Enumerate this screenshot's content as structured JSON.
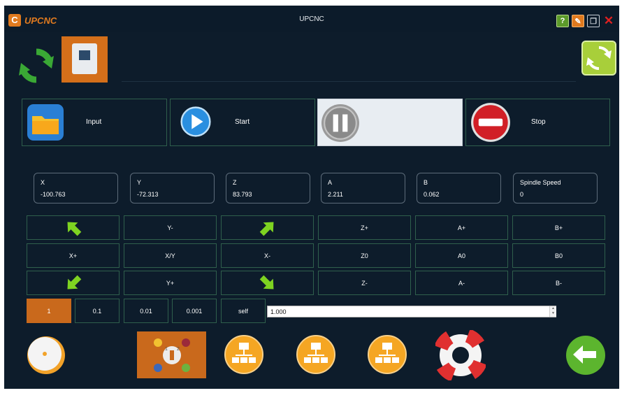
{
  "app": {
    "logo_text": "UPCNC",
    "logo_mark": "C",
    "title": "UPCNC"
  },
  "actions": [
    {
      "label": "Input",
      "icon": "folder-icon"
    },
    {
      "label": "Start",
      "icon": "play-icon"
    },
    {
      "label": "",
      "icon": "pause-icon",
      "active": true
    },
    {
      "label": "Stop",
      "icon": "stop-icon"
    }
  ],
  "readouts": [
    {
      "name": "X",
      "value": "-100.763"
    },
    {
      "name": "Y",
      "value": "-72.313"
    },
    {
      "name": "Z",
      "value": "83.793"
    },
    {
      "name": "A",
      "value": "2.211"
    },
    {
      "name": "B",
      "value": "0.062"
    },
    {
      "name": "Spindle Speed",
      "value": "0"
    }
  ],
  "jog": {
    "row1": [
      "",
      "Y-",
      "",
      "Z+",
      "A+",
      "B+"
    ],
    "row2": [
      "X+",
      "X/Y",
      "X-",
      "Z0",
      "A0",
      "B0"
    ],
    "row3": [
      "",
      "Y+",
      "",
      "Z-",
      "A-",
      "B-"
    ]
  },
  "steps": [
    "1",
    "0.1",
    "0.01",
    "0.001",
    "self"
  ],
  "step_value": "1.000",
  "selected_step": "1",
  "colors": {
    "accent": "#c9691c",
    "background": "#0d1c2b",
    "border": "#2f5f4c",
    "green": "#5cb52e"
  }
}
